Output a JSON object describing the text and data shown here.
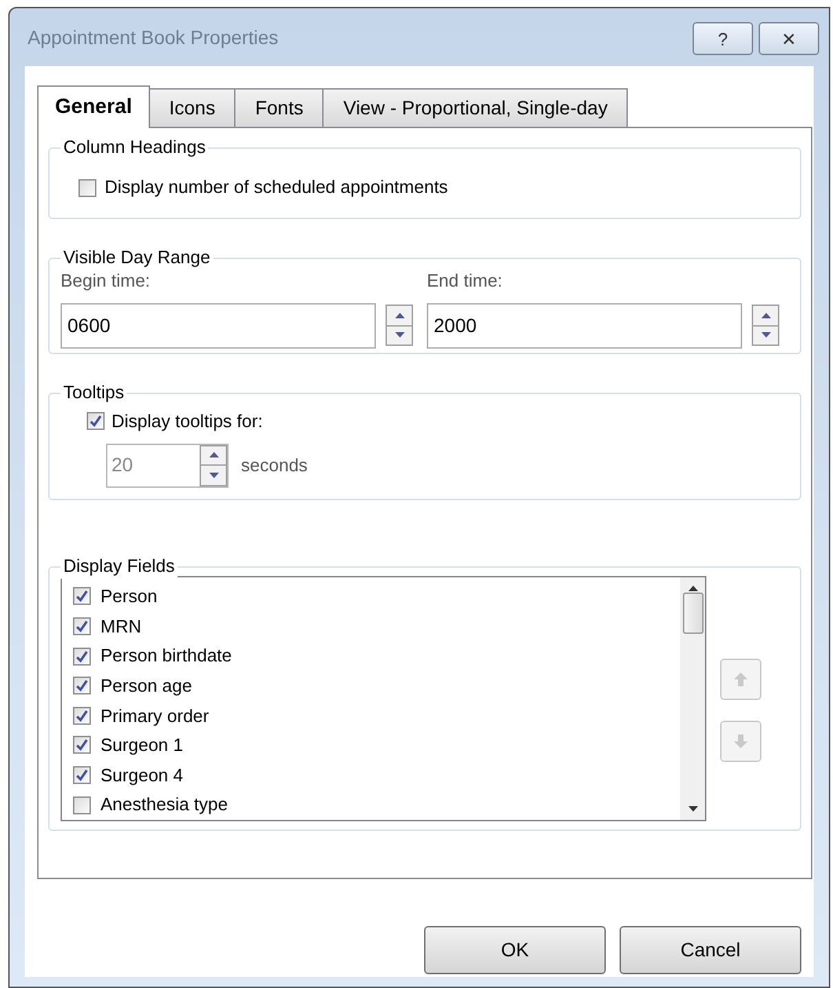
{
  "window": {
    "title": "Appointment Book Properties",
    "buttons": [
      "?",
      "✕"
    ]
  },
  "tabs": [
    {
      "label": "General",
      "selected": true
    },
    {
      "label": "Icons",
      "selected": false
    },
    {
      "label": "Fonts",
      "selected": false
    },
    {
      "label": "View - Proportional, Single-day",
      "selected": false
    }
  ],
  "column_headings": {
    "title": "Column Headings",
    "option": {
      "label": "Display number of scheduled appointments",
      "checked": false
    }
  },
  "visible_day_range": {
    "title": "Visible Day Range",
    "fields": [
      {
        "label": "Begin time:",
        "value": "0600"
      },
      {
        "label": "End time:",
        "value": "2000"
      }
    ]
  },
  "tooltips": {
    "title": "Tooltips",
    "option": {
      "label": "Display tooltips for:",
      "checked": true
    },
    "duration": {
      "value": "20",
      "disabled": true
    },
    "unit": "seconds"
  },
  "display_fields": {
    "title": "Display Fields",
    "items": [
      {
        "label": "Person",
        "checked": true
      },
      {
        "label": "MRN",
        "checked": true
      },
      {
        "label": "Person birthdate",
        "checked": true
      },
      {
        "label": "Person age",
        "checked": true
      },
      {
        "label": "Primary order",
        "checked": true
      },
      {
        "label": "Surgeon 1",
        "checked": true
      },
      {
        "label": "Surgeon 4",
        "checked": true
      },
      {
        "label": "Anesthesia type",
        "checked": false
      }
    ],
    "move_up_disabled": true,
    "move_down_disabled": true
  },
  "buttons": [
    {
      "label": "OK"
    },
    {
      "label": "Cancel"
    }
  ]
}
